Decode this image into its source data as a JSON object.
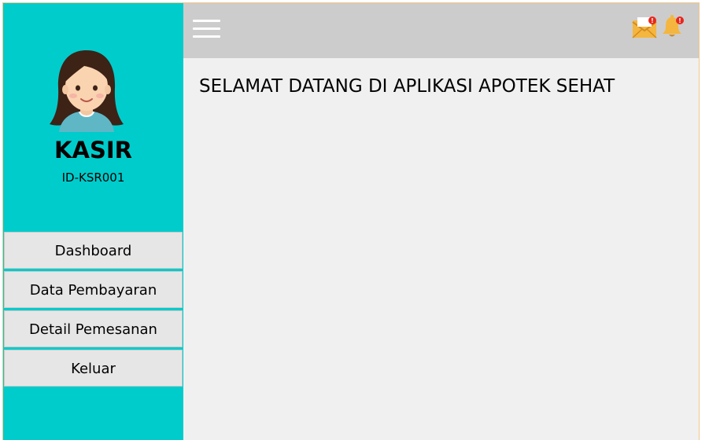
{
  "sidebar": {
    "role": "KASIR",
    "user_id": "ID-KSR001",
    "menu": [
      {
        "label": "Dashboard"
      },
      {
        "label": "Data Pembayaran"
      },
      {
        "label": "Detail Pemesanan"
      },
      {
        "label": "Keluar"
      }
    ]
  },
  "topbar": {
    "icons": [
      "hamburger-menu-icon",
      "mail-notification-icon",
      "bell-notification-icon"
    ],
    "mail_badge": "!",
    "bell_badge": "!"
  },
  "main": {
    "welcome": "SELAMAT DATANG DI APLIKASI APOTEK SEHAT"
  },
  "colors": {
    "sidebar": "#00cccc",
    "topbar": "#cccccc",
    "content": "#f0f0f0",
    "menu_button": "#e6e6e6",
    "badge": "#e8261c",
    "window_border": "#f3c98a"
  }
}
